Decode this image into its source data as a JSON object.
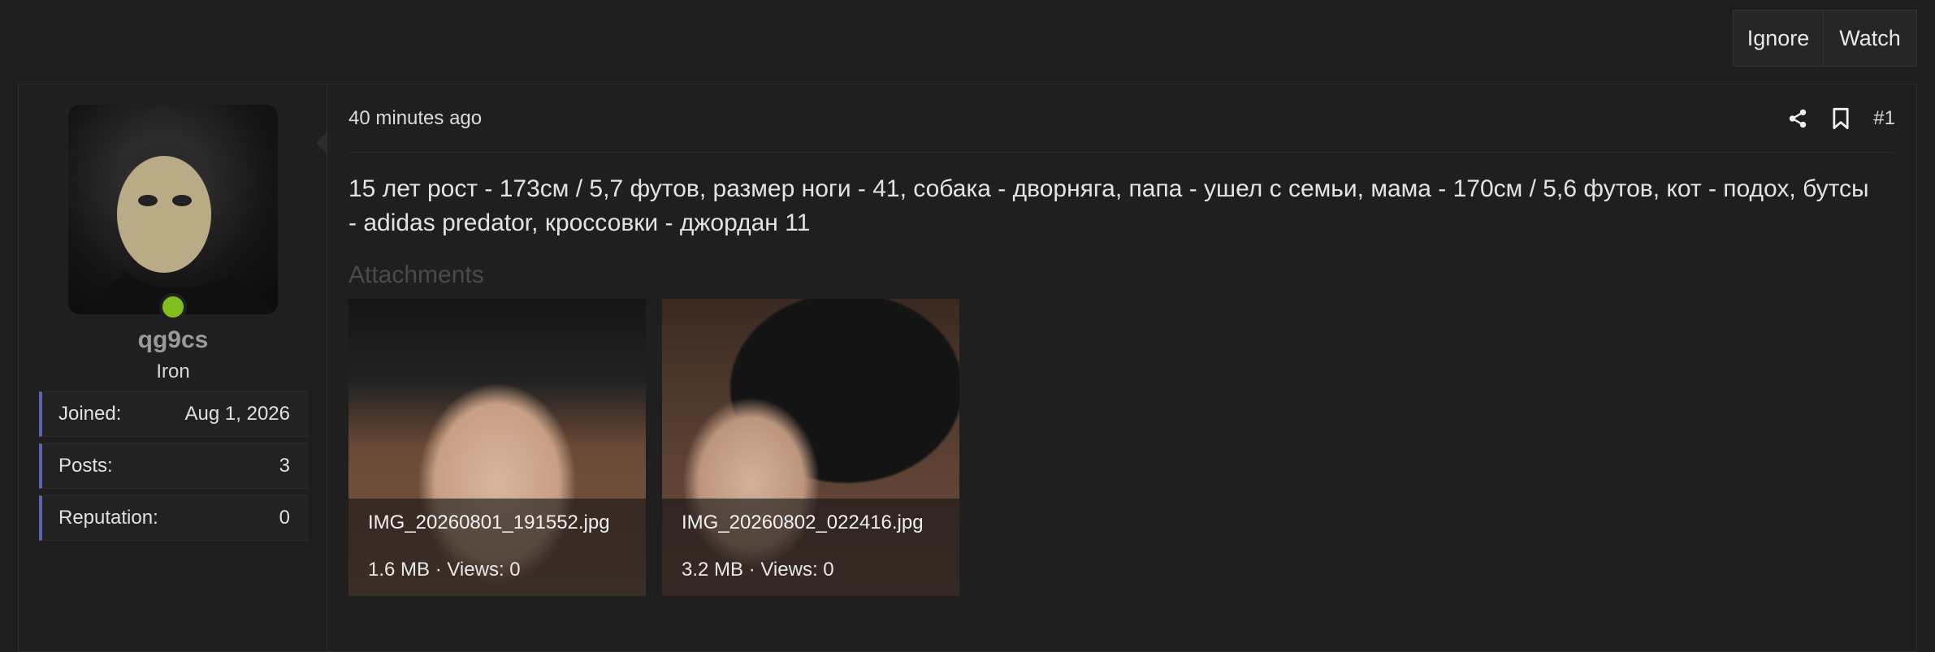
{
  "actions": {
    "ignore_label": "Ignore",
    "watch_label": "Watch"
  },
  "user": {
    "username": "qg9cs",
    "title": "Iron",
    "online": true,
    "online_color": "#7fbf1e",
    "stats": [
      {
        "label": "Joined:",
        "value": "Aug 1, 2026"
      },
      {
        "label": "Posts:",
        "value": "3"
      },
      {
        "label": "Reputation:",
        "value": "0"
      }
    ]
  },
  "post": {
    "timestamp": "40 minutes ago",
    "number": "#1",
    "body": "15 лет рост - 173см / 5,7 футов, размер ноги - 41, собака - дворняга, папа - ушел с семьи, мама - 170см / 5,6 футов, кот - подох, бутсы - adidas predator, кроссовки - джордан 11",
    "share_icon": "share-icon",
    "bookmark_icon": "bookmark-icon"
  },
  "attachments": {
    "title": "Attachments",
    "items": [
      {
        "name": "IMG_20260801_191552.jpg",
        "meta": "1.6 MB · Views: 0"
      },
      {
        "name": "IMG_20260802_022416.jpg",
        "meta": "3.2 MB · Views: 0"
      }
    ]
  },
  "colors": {
    "accent_border": "#5b62b0",
    "background": "#1e1e1e"
  }
}
